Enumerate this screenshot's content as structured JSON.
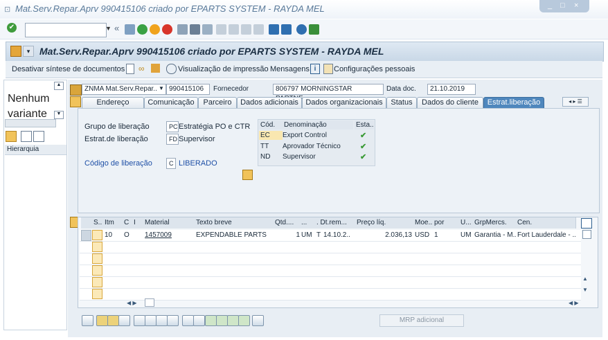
{
  "window": {
    "title": "Mat.Serv.Repar.Aprv 990415106 criado por EPARTS SYSTEM - RAYDA MEL",
    "controls": "_ □ ×"
  },
  "toolbar": {
    "command_field_value": "",
    "back_symbol": "«"
  },
  "header": {
    "title": "Mat.Serv.Repar.Aprv 990415106 criado por EPARTS SYSTEM - RAYDA MEL"
  },
  "app_toolbar": {
    "deactivate_summary": "Desativar síntese de documentos",
    "print_preview": "Visualização de impressão",
    "messages": "Mensagens",
    "personal_settings": "Configurações pessoais"
  },
  "left_panel": {
    "no_variant_line1": "Nenhum",
    "no_variant_line2": "variante",
    "hierarchy_tab": "Hierarquia"
  },
  "doc_header": {
    "doc_type": "ZNMA Mat.Serv.Repar..",
    "doc_number": "990415106",
    "vendor_label": "Fornecedor",
    "vendor_value": "806797 MORNINGSTAR PARTNE..",
    "doc_date_label": "Data doc.",
    "doc_date_value": "21.10.2019"
  },
  "tabs": [
    {
      "label": "Endereço"
    },
    {
      "label": "Comunicação"
    },
    {
      "label": "Parceiro"
    },
    {
      "label": "Dados adicionais"
    },
    {
      "label": "Dados organizacionais"
    },
    {
      "label": "Status"
    },
    {
      "label": "Dados do cliente"
    },
    {
      "label": "Estrat.liberação"
    }
  ],
  "release": {
    "group_label": "Grupo de liberação",
    "group_code": "PC",
    "group_text": "Estratégia PO e CTR",
    "strategy_label": "Estrat.de liberação",
    "strategy_code": "FD",
    "strategy_text": "Supervisor",
    "indicator_label": "Código de liberação",
    "indicator_code": "C",
    "indicator_text": "LIBERADO",
    "table": {
      "columns": [
        "Cód.",
        "Denominação",
        "Esta.."
      ],
      "rows": [
        {
          "code": "EC",
          "name": "Export Control"
        },
        {
          "code": "TT",
          "name": "Aprovador Técnico"
        },
        {
          "code": "ND",
          "name": "Supervisor"
        }
      ],
      "status_symbol": "✔"
    }
  },
  "items": {
    "columns": [
      "S..",
      "Itm",
      "C",
      "I",
      "Material",
      "Texto breve",
      "Qtd....",
      "...",
      ". Dt.rem...",
      "Preço líq.",
      "Moe...",
      "por",
      "U...",
      "GrpMercs.",
      "Cen."
    ],
    "rows": [
      {
        "itm": "10",
        "c": "O",
        "material": "1457009",
        "short_text": "EXPENDABLE PARTS",
        "qty": "1",
        "unit": "UM",
        "cat": "T",
        "delivery": "14.10.2..",
        "price": "2.036,13",
        "currency": "USD",
        "per": "1",
        "order_unit": "UM",
        "mat_group": "Garantia - M..",
        "plant": "Fort Lauderdale - .."
      }
    ],
    "empty_rows": 6
  },
  "bottom": {
    "mrp_button": "MRP adicional"
  }
}
